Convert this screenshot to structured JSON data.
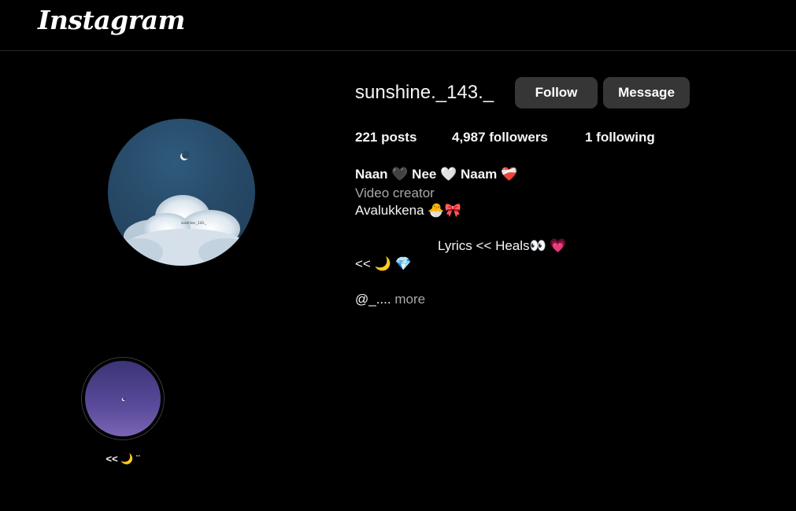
{
  "app": {
    "logo": "Instagram"
  },
  "profile": {
    "username": "sunshine._143._",
    "follow_label": "Follow",
    "message_label": "Message",
    "stats": {
      "posts": "221 posts",
      "followers": "4,987 followers",
      "following": "1 following"
    },
    "name": "Naan 🖤 Nee 🤍 Naam ❤️‍🩹",
    "category": "Video creator",
    "bio_line1": "Avalukkena 🐣🎀",
    "bio_line2": "Lyrics << Heals👀 💗",
    "bio_line3": "<< 🌙 💎",
    "bio_link": "@_....",
    "more_label": "more",
    "avatar_caption": "sunshine._143._"
  },
  "highlights": [
    {
      "label": "<< 🌙 ¨"
    }
  ],
  "colors": {
    "background": "#000000",
    "button": "#363636",
    "secondary_text": "#a8a8a8"
  }
}
